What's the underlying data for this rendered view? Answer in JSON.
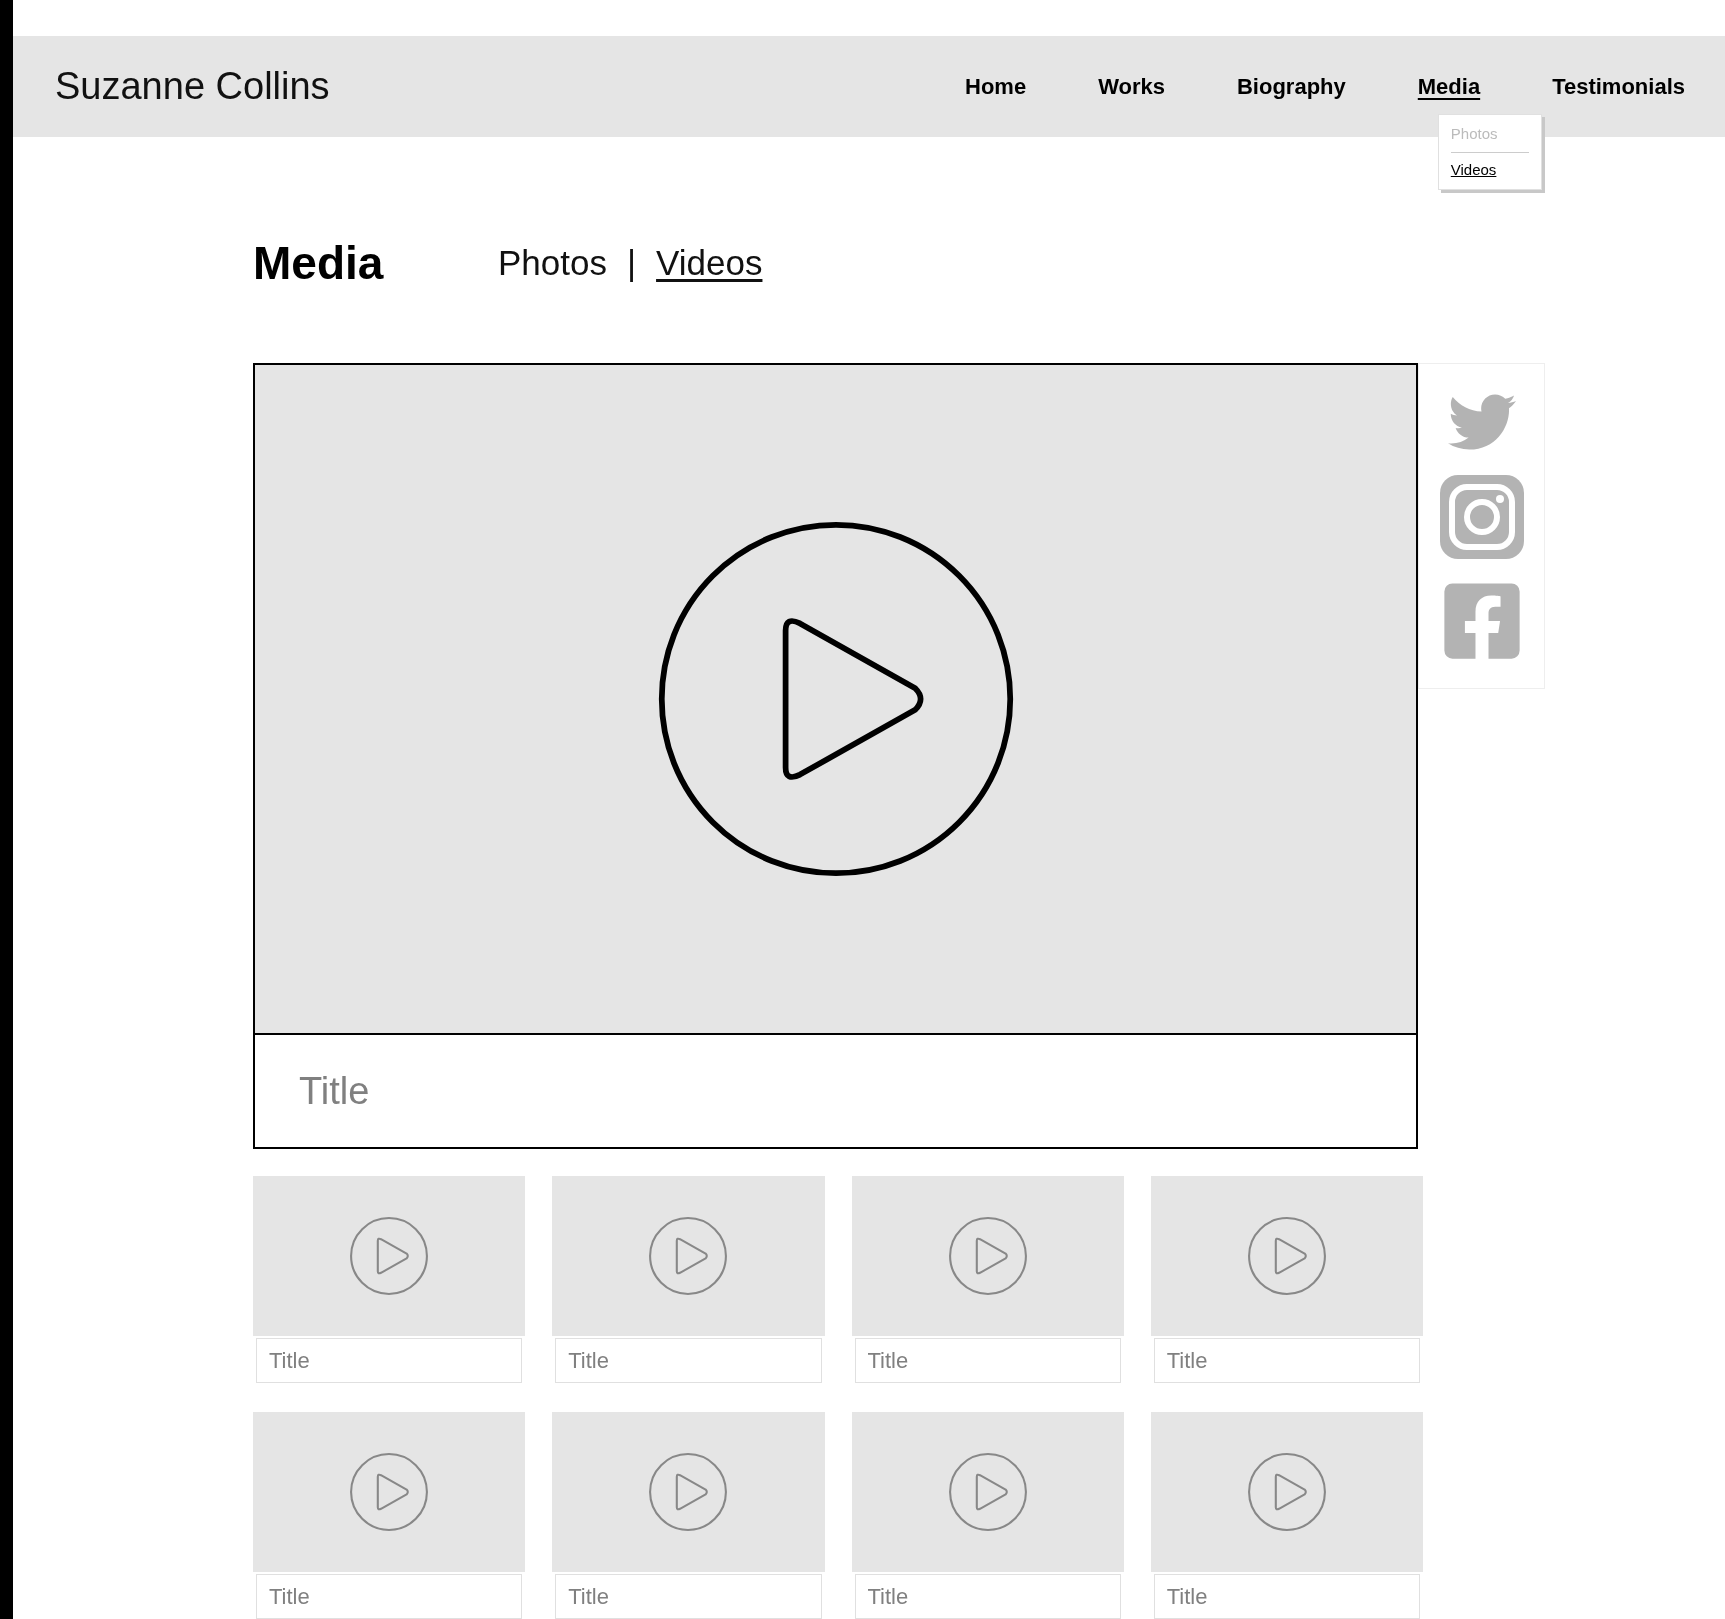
{
  "site_title": "Suzanne Collins",
  "nav": [
    {
      "label": "Home",
      "selected": false
    },
    {
      "label": "Works",
      "selected": false
    },
    {
      "label": "Biography",
      "selected": false
    },
    {
      "label": "Media",
      "selected": true
    },
    {
      "label": "Testimonials",
      "selected": false
    }
  ],
  "dropdown": [
    {
      "label": "Photos",
      "selected": false
    },
    {
      "label": "Videos",
      "selected": true
    }
  ],
  "page_heading": "Media",
  "subnav": [
    {
      "label": "Photos",
      "selected": false
    },
    {
      "label": "Videos",
      "selected": true
    }
  ],
  "subnav_separator": "|",
  "featured_video": {
    "title": "Title"
  },
  "videos": [
    {
      "title": "Title"
    },
    {
      "title": "Title"
    },
    {
      "title": "Title"
    },
    {
      "title": "Title"
    },
    {
      "title": "Title"
    },
    {
      "title": "Title"
    },
    {
      "title": "Title"
    },
    {
      "title": "Title"
    }
  ]
}
